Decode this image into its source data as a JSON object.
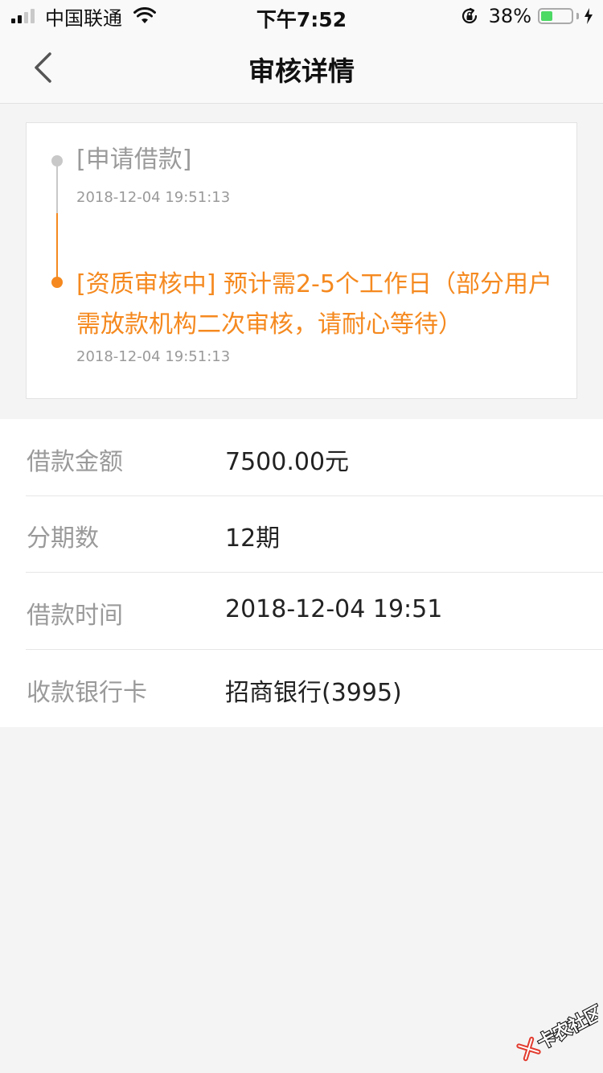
{
  "status_bar": {
    "carrier": "中国联通",
    "time": "下午7:52",
    "battery_percent": "38%",
    "battery_level": 0.38
  },
  "nav": {
    "title": "审核详情"
  },
  "timeline": [
    {
      "title": "[申请借款]",
      "time": "2018-12-04 19:51:13",
      "state": "done",
      "color": "#c8c8c8"
    },
    {
      "title": "[资质审核中] 预计需2-5个工作日（部分用户需放款机构二次审核，请耐心等待）",
      "time": "2018-12-04 19:51:13",
      "state": "active",
      "color": "#f5891f"
    }
  ],
  "details": [
    {
      "label": "借款金额",
      "value": "7500.00元"
    },
    {
      "label": "分期数",
      "value": "12期"
    },
    {
      "label": "借款时间",
      "value": "2018-12-04 19:51"
    },
    {
      "label": "收款银行卡",
      "value": "招商银行(3995)"
    }
  ],
  "watermark": {
    "text": "卡农社区"
  },
  "colors": {
    "accent": "#f5891f",
    "muted": "#9a9a9a",
    "battery": "#4cd964"
  }
}
